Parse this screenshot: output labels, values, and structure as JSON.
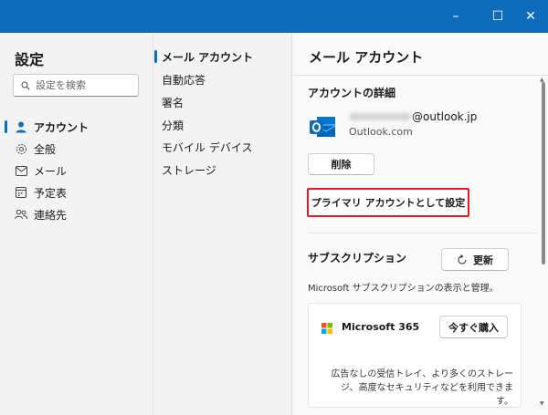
{
  "window": {
    "controls": {
      "minimize": "–",
      "maximize": "☐",
      "close": "✕"
    }
  },
  "nav": {
    "title": "設定",
    "search_placeholder": "設定を検索",
    "items": [
      {
        "label": "アカウント",
        "icon": "person-icon",
        "active": true
      },
      {
        "label": "全般",
        "icon": "gear-icon",
        "active": false
      },
      {
        "label": "メール",
        "icon": "mail-icon",
        "active": false
      },
      {
        "label": "予定表",
        "icon": "calendar-icon",
        "active": false
      },
      {
        "label": "連絡先",
        "icon": "people-icon",
        "active": false
      }
    ]
  },
  "submenu": {
    "items": [
      {
        "label": "メール アカウント",
        "active": true
      },
      {
        "label": "自動応答",
        "active": false
      },
      {
        "label": "署名",
        "active": false
      },
      {
        "label": "分類",
        "active": false
      },
      {
        "label": "モバイル デバイス",
        "active": false
      },
      {
        "label": "ストレージ",
        "active": false
      }
    ]
  },
  "main": {
    "title": "メール アカウント",
    "details_title": "アカウントの詳細",
    "email_domain": "@outlook.jp",
    "account_type": "Outlook.com",
    "delete_label": "削除",
    "set_primary_label": "プライマリ アカウントとして設定",
    "subscription_title": "サブスクリプション",
    "refresh_label": "更新",
    "subscription_desc": "Microsoft サブスクリプションの表示と管理。",
    "product_name": "Microsoft 365",
    "buy_label": "今すぐ購入",
    "product_desc_line1": "広告なしの受信トレイ、より多くのストレー",
    "product_desc_line2": "ジ、高度なセキュリティなどを利用できます。"
  },
  "colors": {
    "titlebar": "#0f6cbd",
    "accent": "#0f6cbd",
    "highlight": "#e11b22"
  }
}
